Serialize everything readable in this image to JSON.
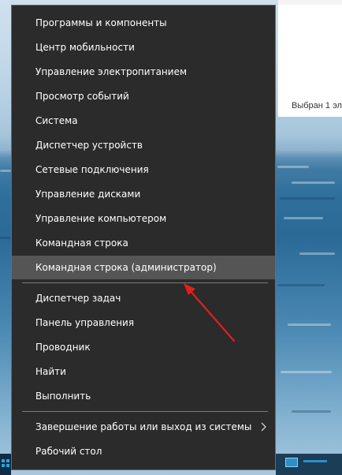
{
  "menu": {
    "items": [
      {
        "label": "Программы и компоненты",
        "top": 0
      },
      {
        "label": "Центр мобильности"
      },
      {
        "label": "Управление электропитанием"
      },
      {
        "label": "Просмотр событий"
      },
      {
        "label": "Система"
      },
      {
        "label": "Диспетчер устройств"
      },
      {
        "label": "Сетевые подключения"
      },
      {
        "label": "Управление дисками"
      },
      {
        "label": "Управление компьютером"
      },
      {
        "label": "Командная строка"
      },
      {
        "label": "Командная строка (администратор)",
        "highlighted": true
      }
    ],
    "items2": [
      {
        "label": "Диспетчер задач"
      },
      {
        "label": "Панель управления"
      },
      {
        "label": "Проводник"
      },
      {
        "label": "Найти"
      },
      {
        "label": "Выполнить"
      }
    ],
    "items3": [
      {
        "label": "Завершение работы или выход из системы",
        "has_submenu": true
      },
      {
        "label": "Рабочий стол"
      }
    ]
  },
  "explorer": {
    "status_text": "Выбран 1 эл"
  },
  "colors": {
    "menu_bg": "#2b2b2b",
    "menu_highlight": "#555555",
    "menu_text": "#ffffff",
    "annotation_arrow": "#e0201e",
    "taskbar_accent": "#2f8fc9"
  },
  "icons": {
    "start": "windows-start-icon",
    "keyboard": "keyboard-layout-icon",
    "submenu": "chevron-right-icon",
    "annotation": "red-arrow-annotation"
  }
}
